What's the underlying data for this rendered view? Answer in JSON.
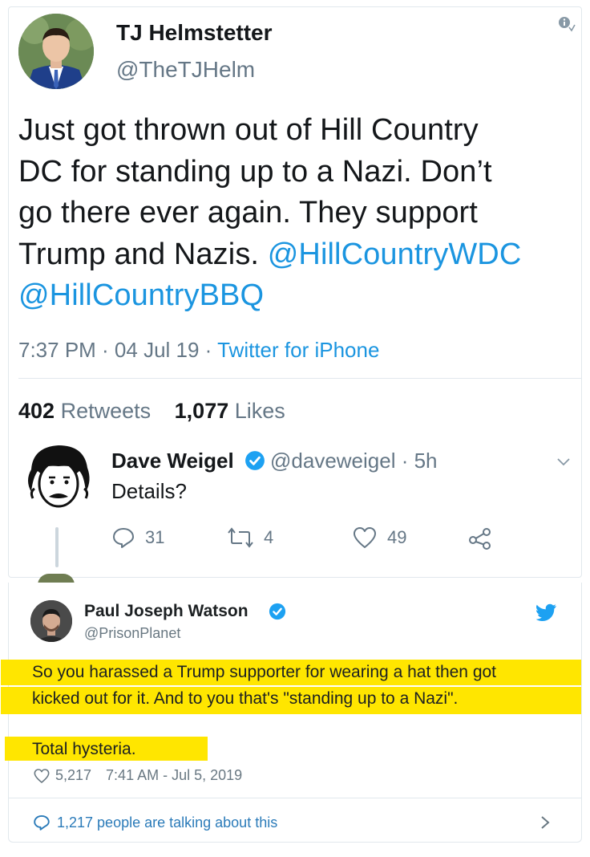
{
  "main_tweet": {
    "author_name": "TJ Helmstetter",
    "author_handle": "@TheTJHelm",
    "text_lines": [
      "Just got thrown out of Hill Country",
      "DC for standing up to a Nazi. Don’t",
      "go there ever again. They support",
      "Trump and Nazis. ",
      "@HillCountryBBQ"
    ],
    "mention_1": "@HillCountryWDC",
    "time": "7:37 PM · 04 Jul 19 · ",
    "source": "Twitter for iPhone",
    "retweets_count": "402",
    "retweets_label": "Retweets",
    "likes_count": "1,077",
    "likes_label": "Likes"
  },
  "reply": {
    "author_name": "Dave Weigel",
    "author_handle": "@daveweigel · 5h",
    "text": "Details?",
    "reply_count": "31",
    "retweet_count": "4",
    "like_count": "49"
  },
  "embedded_tweet": {
    "author_name": "Paul Joseph Watson",
    "author_handle": "@PrisonPlanet",
    "lines": [
      "So you harassed a Trump supporter for wearing a hat then got",
      "kicked out for it. And to you that's \"standing up to a Nazi\".",
      "Total hysteria."
    ],
    "like_count": "5,217",
    "timestamp": "7:41 AM - Jul 5, 2019",
    "talking": "1,217 people are talking about this"
  },
  "colors": {
    "link_blue": "#1b95e0",
    "secondary_gray": "#657786",
    "highlight_yellow": "#ffe600",
    "verified_blue": "#1da1f2"
  }
}
